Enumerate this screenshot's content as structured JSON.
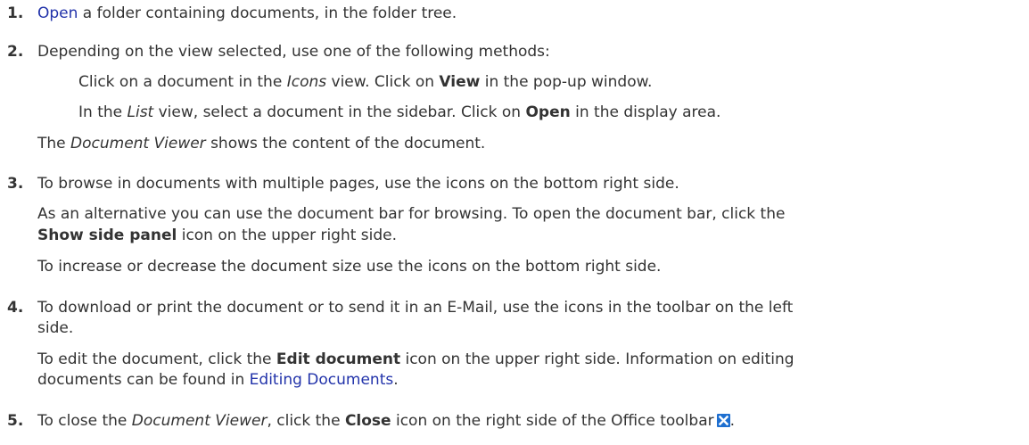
{
  "steps": [
    {
      "number": "1.",
      "link": "Open",
      "text": " a folder containing documents, in the folder tree."
    },
    {
      "number": "2.",
      "text": "Depending on the view selected, use one of the following methods:",
      "sub": [
        {
          "a": "Click on a document in the ",
          "i": "Icons",
          "b": " view. Click on ",
          "bold": "View",
          "c": " in the pop-up window."
        },
        {
          "a": "In the ",
          "i": "List",
          "b": " view, select a document in the sidebar. Click on ",
          "bold": "Open",
          "c": " in the display area."
        }
      ],
      "after": {
        "a": "The ",
        "i": "Document Viewer",
        "b": " shows the content of the document."
      }
    },
    {
      "number": "3.",
      "text": "To browse in documents with multiple pages, use the icons on the bottom right side.",
      "p2a": "As an alternative you can use the document bar for browsing. To open the document bar, click the",
      "p2bold": "Show side panel",
      "p2b": " icon on the upper right side.",
      "p3": "To increase or decrease the document size use the icons on the bottom right side."
    },
    {
      "number": "4.",
      "text": "To download or print the document or to send it in an E-Mail, use the icons in the toolbar on the left",
      "text2": "side.",
      "p2a": "To edit the document, click the ",
      "p2bold": "Edit document",
      "p2b": " icon on the upper right side. Information on editing",
      "p2c": "documents can be found in ",
      "p2link": "Editing Documents",
      "p2d": "."
    },
    {
      "number": "5.",
      "a": "To close the ",
      "i": "Document Viewer",
      "b": ", click the ",
      "bold": "Close",
      "c": " icon on the right side of the Office toolbar"
    }
  ],
  "icon_colors": {
    "close_bg": "#1e6fd0"
  }
}
